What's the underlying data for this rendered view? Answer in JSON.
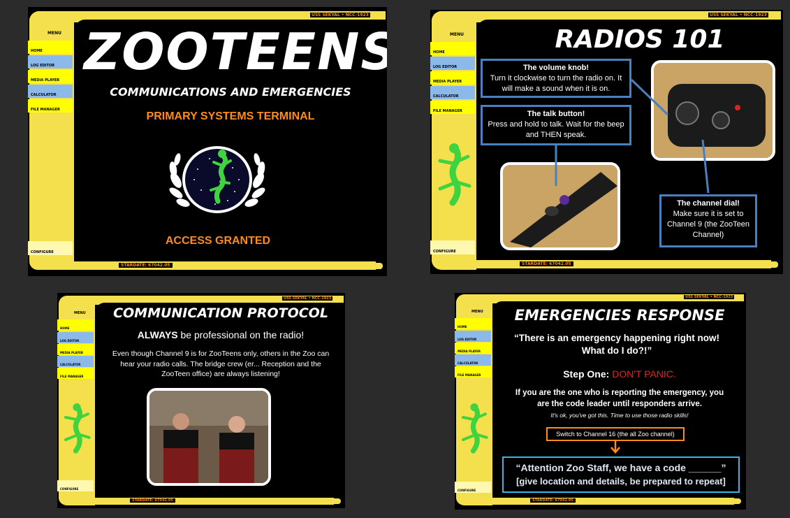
{
  "lcars": {
    "ship": "USS SEKYAL",
    "registry": "NCC-1923",
    "stardate": "STARDATE: 67042.05",
    "menu": "MENU",
    "home": "HOME",
    "log_editor": "LOG EDITOR",
    "media_player": "MEDIA PLAYER",
    "calculator": "CALCULATOR",
    "file_manager": "FILE MANAGER",
    "configure": "CONFIGURE"
  },
  "slide1": {
    "title": "ZOOTEENS",
    "subtitle": "COMMUNICATIONS AND EMERGENCIES",
    "terminal": "PRIMARY SYSTEMS TERMINAL",
    "status": "ACCESS GRANTED"
  },
  "slide2": {
    "title": "RADIOS 101",
    "volume_title": "The volume knob!",
    "volume_body": "Turn it clockwise to turn the radio on. It will make a sound when it is on.",
    "talk_title": "The talk button!",
    "talk_body": "Press and hold to talk. Wait for the beep and THEN speak.",
    "channel_title": "The channel dial!",
    "channel_body": "Make sure it is set to Channel 9 (the ZooTeen Channel)"
  },
  "slide3": {
    "title": "COMMUNICATION PROTOCOL",
    "headline_bold": "ALWAYS",
    "headline_rest": " be professional on the radio!",
    "body": "Even though Channel 9 is for ZooTeens only, others in the Zoo can hear your radio calls. The bridge crew (er... Reception and the ZooTeen office) are always listening!"
  },
  "slide4": {
    "title": "EMERGENCIES RESPONSE",
    "quote": "“There is an emergency happening right now! What do I do?!”",
    "step_label": "Step One:",
    "step_value": "DON'T PANIC.",
    "leader": "If you are the one who is reporting the emergency, you are the code leader until responders arrive.",
    "encourage": "It's ok, you've got this. Time to use those radio skills!",
    "switch": "Switch to Channel 16 (the all Zoo channel)",
    "attention": "“Attention Zoo Staff, we have a code ______”",
    "location": "[give location and details, be prepared to repeat]"
  },
  "colors": {
    "lcars_yellow": "#f4e04d",
    "lcars_blue": "#8ab9ea",
    "accent_orange": "#ff8c1a",
    "callout_blue": "#4a7fc0",
    "gecko_green": "#3fd33f"
  }
}
